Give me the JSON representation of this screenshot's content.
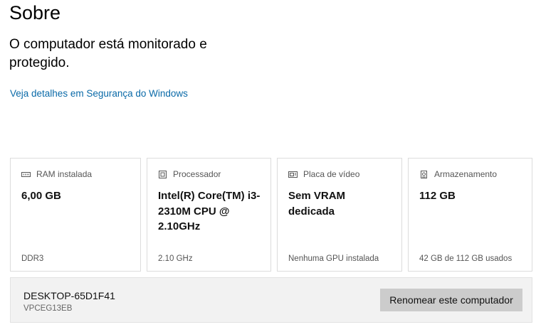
{
  "page": {
    "title": "Sobre",
    "status": "O computador está monitorado e protegido.",
    "link": "Veja detalhes em Segurança do Windows"
  },
  "cards": [
    {
      "icon": "ram-icon",
      "label": "RAM instalada",
      "value": "6,00 GB",
      "detail": "DDR3"
    },
    {
      "icon": "processor-icon",
      "label": "Processador",
      "value": "Intel(R) Core(TM) i3-2310M CPU @ 2.10GHz",
      "detail": "2.10 GHz"
    },
    {
      "icon": "display-adapter-icon",
      "label": "Placa de vídeo",
      "value": "Sem VRAM dedicada",
      "detail": "Nenhuma GPU instalada"
    },
    {
      "icon": "storage-icon",
      "label": "Armazenamento",
      "value": "112 GB",
      "detail": "42 GB de 112 GB usados"
    }
  ],
  "device": {
    "name": "DESKTOP-65D1F41",
    "model": "VPCEG13EB",
    "rename_label": "Renomear este computador"
  }
}
